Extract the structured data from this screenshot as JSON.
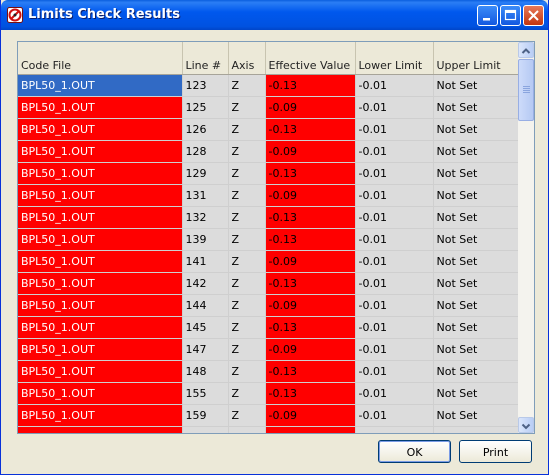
{
  "window": {
    "title": "Limits Check Results"
  },
  "columns": [
    {
      "label": "Code File"
    },
    {
      "label": "Line #"
    },
    {
      "label": "Axis"
    },
    {
      "label": "Effective Value"
    },
    {
      "label": "Lower Limit"
    },
    {
      "label": "Upper Limit"
    }
  ],
  "rows": [
    {
      "code_file": "BPL50_1.OUT",
      "line": "123",
      "axis": "Z",
      "effective": "-0.13",
      "lower": "-0.01",
      "upper": "Not Set",
      "selected": true
    },
    {
      "code_file": "BPL50_1.OUT",
      "line": "125",
      "axis": "Z",
      "effective": "-0.09",
      "lower": "-0.01",
      "upper": "Not Set"
    },
    {
      "code_file": "BPL50_1.OUT",
      "line": "126",
      "axis": "Z",
      "effective": "-0.13",
      "lower": "-0.01",
      "upper": "Not Set"
    },
    {
      "code_file": "BPL50_1.OUT",
      "line": "128",
      "axis": "Z",
      "effective": "-0.09",
      "lower": "-0.01",
      "upper": "Not Set"
    },
    {
      "code_file": "BPL50_1.OUT",
      "line": "129",
      "axis": "Z",
      "effective": "-0.13",
      "lower": "-0.01",
      "upper": "Not Set"
    },
    {
      "code_file": "BPL50_1.OUT",
      "line": "131",
      "axis": "Z",
      "effective": "-0.09",
      "lower": "-0.01",
      "upper": "Not Set"
    },
    {
      "code_file": "BPL50_1.OUT",
      "line": "132",
      "axis": "Z",
      "effective": "-0.13",
      "lower": "-0.01",
      "upper": "Not Set"
    },
    {
      "code_file": "BPL50_1.OUT",
      "line": "139",
      "axis": "Z",
      "effective": "-0.13",
      "lower": "-0.01",
      "upper": "Not Set"
    },
    {
      "code_file": "BPL50_1.OUT",
      "line": "141",
      "axis": "Z",
      "effective": "-0.09",
      "lower": "-0.01",
      "upper": "Not Set"
    },
    {
      "code_file": "BPL50_1.OUT",
      "line": "142",
      "axis": "Z",
      "effective": "-0.13",
      "lower": "-0.01",
      "upper": "Not Set"
    },
    {
      "code_file": "BPL50_1.OUT",
      "line": "144",
      "axis": "Z",
      "effective": "-0.09",
      "lower": "-0.01",
      "upper": "Not Set"
    },
    {
      "code_file": "BPL50_1.OUT",
      "line": "145",
      "axis": "Z",
      "effective": "-0.13",
      "lower": "-0.01",
      "upper": "Not Set"
    },
    {
      "code_file": "BPL50_1.OUT",
      "line": "147",
      "axis": "Z",
      "effective": "-0.09",
      "lower": "-0.01",
      "upper": "Not Set"
    },
    {
      "code_file": "BPL50_1.OUT",
      "line": "148",
      "axis": "Z",
      "effective": "-0.13",
      "lower": "-0.01",
      "upper": "Not Set"
    },
    {
      "code_file": "BPL50_1.OUT",
      "line": "155",
      "axis": "Z",
      "effective": "-0.13",
      "lower": "-0.01",
      "upper": "Not Set"
    },
    {
      "code_file": "BPL50_1.OUT",
      "line": "159",
      "axis": "Z",
      "effective": "-0.09",
      "lower": "-0.01",
      "upper": "Not Set"
    },
    {
      "code_file": "",
      "line": "",
      "axis": "",
      "effective": "",
      "lower": "",
      "upper": ""
    }
  ],
  "buttons": {
    "ok": "OK",
    "print": "Print"
  },
  "colors": {
    "error": "#ff0000",
    "selected": "#316ac5",
    "gray_cell": "#dcdcdc",
    "titlebar": "#0058ee"
  },
  "icons": {
    "app": "limits-check-app-icon",
    "minimize": "minimize-icon",
    "maximize": "maximize-icon",
    "close": "close-icon"
  }
}
